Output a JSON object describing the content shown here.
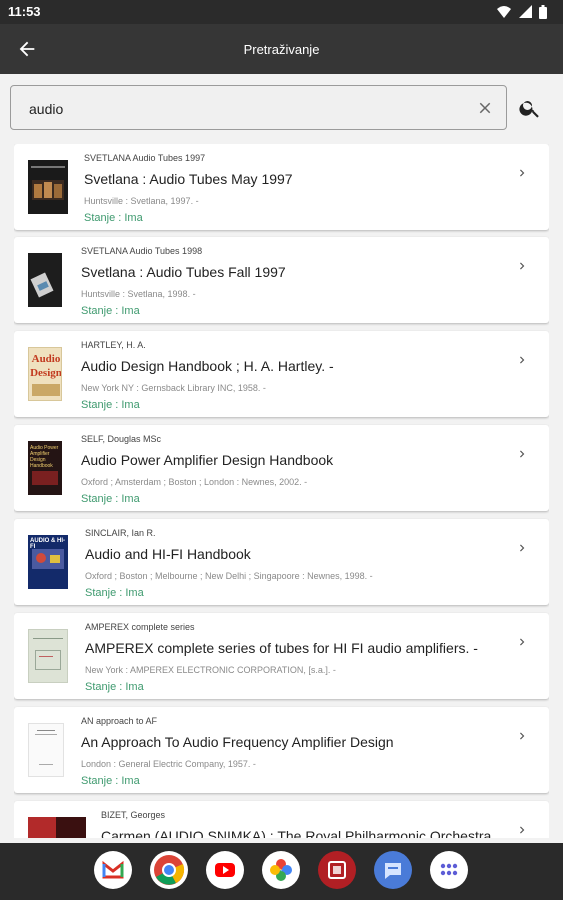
{
  "status_bar": {
    "time": "11:53"
  },
  "app_bar": {
    "title": "Pretraživanje"
  },
  "search": {
    "value": "audio"
  },
  "results": [
    {
      "author": "SVETLANA Audio Tubes 1997",
      "title": "Svetlana : Audio Tubes May 1997",
      "publication": "Huntsville : Svetlana, 1997. -",
      "status": "Stanje : Ima"
    },
    {
      "author": "SVETLANA Audio Tubes 1998",
      "title": "Svetlana : Audio Tubes Fall 1997",
      "publication": "Huntsville : Svetlana, 1998. -",
      "status": "Stanje : Ima"
    },
    {
      "author": "HARTLEY, H. A.",
      "title": "Audio Design Handbook ; H. A. Hartley. -",
      "publication": "New York NY : Gernsback Library INC, 1958. -",
      "status": "Stanje : Ima"
    },
    {
      "author": "SELF, Douglas MSc",
      "title": "Audio Power Amplifier Design Handbook",
      "publication": "Oxford ; Amsterdam ; Boston ; London : Newnes, 2002. -",
      "status": "Stanje : Ima"
    },
    {
      "author": "SINCLAIR, Ian R.",
      "title": "Audio and HI-FI Handbook",
      "publication": "Oxford ; Boston ; Melbourne ; New Delhi ; Singapoore : Newnes, 1998. -",
      "status": "Stanje : Ima"
    },
    {
      "author": "AMPEREX complete series",
      "title": "AMPEREX complete series of tubes for HI FI audio amplifiers. -",
      "publication": "New York : AMPEREX ELECTRONIC CORPORATION, [s.a.]. -",
      "status": "Stanje : Ima"
    },
    {
      "author": "AN approach to AF",
      "title": "An Approach To Audio Frequency Amplifier Design",
      "publication": "London : General Electric Company, 1957. -",
      "status": "Stanje : Ima"
    },
    {
      "author": "BIZET, Georges",
      "title": "Carmen (AUDIO SNIMKA) : The Royal Philharmonic Orchestra",
      "publication": "",
      "status": ""
    }
  ],
  "cover_art": {
    "2": {
      "line1": "Audio",
      "line2": "Design"
    },
    "3": {
      "text": "Audio Power Amplifier Design Handbook"
    },
    "4": {
      "text": "AUDIO & HI-FI"
    }
  },
  "dock_apps": [
    "gmail-icon",
    "chrome-icon",
    "youtube-icon",
    "photos-icon",
    "app-icon",
    "messages-icon",
    "app-drawer-icon"
  ],
  "colors": {
    "status_text": "#3f9a6f",
    "app_bar": "#363636",
    "status_bar": "#2b2b2b",
    "dock": "#2a2a2a",
    "background": "#f2f2f2"
  }
}
